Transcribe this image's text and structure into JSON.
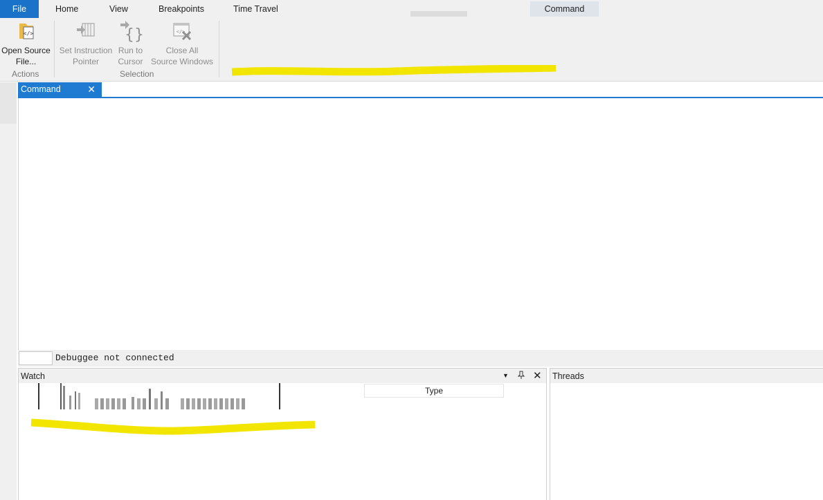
{
  "menu": {
    "file": "File",
    "home": "Home",
    "view": "View",
    "breakpoints": "Breakpoints",
    "time_travel": "Time Travel",
    "command": "Command"
  },
  "ribbon": {
    "open_source_file": {
      "line1": "Open Source",
      "line2": "File..."
    },
    "set_instruction_pointer": {
      "line1": "Set Instruction",
      "line2": "Pointer"
    },
    "run_to_cursor": {
      "line1": "Run to",
      "line2": "Cursor"
    },
    "close_all_source_windows": {
      "line1": "Close All",
      "line2": "Source Windows"
    },
    "group_actions": "Actions",
    "group_selection": "Selection"
  },
  "command_window": {
    "tab_title": "Command",
    "status": "Debuggee not connected"
  },
  "watch": {
    "title": "Watch",
    "column_type": "Type"
  },
  "threads": {
    "title": "Threads"
  },
  "colors": {
    "accent": "#1f7bd1",
    "highlighter": "#f2e600"
  }
}
